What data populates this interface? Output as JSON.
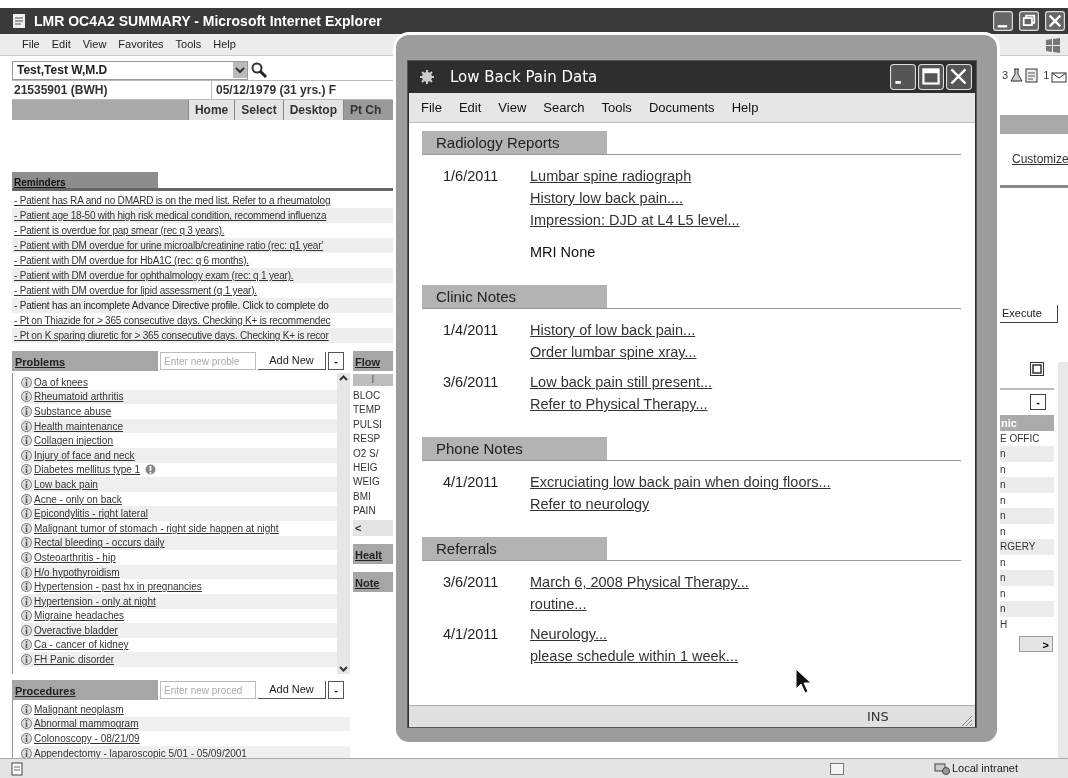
{
  "browser": {
    "title": "LMR OC4A2 SUMMARY - Microsoft Internet Explorer",
    "menu": [
      "File",
      "Edit",
      "View",
      "Favorites",
      "Tools",
      "Help"
    ]
  },
  "patient": {
    "name": "Test,Test W,M.D",
    "mrn": "21535901 (BWH)",
    "dob": "05/12/1979 (31 yrs.) F"
  },
  "nav_tabs": [
    {
      "label": "Home",
      "selected": false
    },
    {
      "label": "Select",
      "selected": false
    },
    {
      "label": "Desktop",
      "selected": false
    },
    {
      "label": "Pt Ch",
      "selected": true
    }
  ],
  "reminders": {
    "title": "Reminders",
    "items": [
      {
        "text": "- Patient has RA and no DMARD is on the med list. Refer to a rheumatolog",
        "link": true
      },
      {
        "text": "- Patient age 18-50 with high risk medical condition, recommend influenza",
        "link": true
      },
      {
        "text": "- Patient is overdue for pap smear (rec q 3 years).",
        "link": true
      },
      {
        "text": "- Patient with DM overdue for urine microalb/creatinine ratio (rec: q1 year'",
        "link": true
      },
      {
        "text": "- Patient with DM overdue for HbA1C (rec: q 6 months).",
        "link": true
      },
      {
        "text": "- Patient with DM overdue for ophthalmology exam (rec: q 1 year).",
        "link": true
      },
      {
        "text": "- Patient with DM overdue for lipid assessment (q 1 year).",
        "link": true
      },
      {
        "text": "- Patient has an incomplete Advance Directive profile. Click to complete do",
        "link": false
      },
      {
        "text": "- Pt on Thiazide for > 365 consecutive days. Checking K+ is recommendec",
        "link": true
      },
      {
        "text": "- Pt on K sparing diuretic for > 365 consecutive days. Checking K+ is recor",
        "link": true
      }
    ]
  },
  "problems": {
    "title": "Problems",
    "placeholder": "Enter new proble",
    "button": "Add New",
    "collapse": "-",
    "items": [
      {
        "text": "Oa of knees",
        "alert": false
      },
      {
        "text": "Rheumatoid arthritis",
        "alert": false
      },
      {
        "text": "Substance abuse",
        "alert": false
      },
      {
        "text": "Health maintenance",
        "alert": false
      },
      {
        "text": "Collagen injection",
        "alert": false
      },
      {
        "text": "Injury of face and neck",
        "alert": false
      },
      {
        "text": "Diabetes mellitus type 1",
        "alert": true
      },
      {
        "text": "Low back pain",
        "alert": false
      },
      {
        "text": "Acne - only on back",
        "alert": false
      },
      {
        "text": "Epicondylitis - right lateral",
        "alert": false
      },
      {
        "text": "Malignant tumor of stomach - right side happen at night",
        "alert": false
      },
      {
        "text": "Rectal bleeding - occurs daily",
        "alert": false
      },
      {
        "text": "Osteoarthritis - hip",
        "alert": false
      },
      {
        "text": "H/o hypothyroidism",
        "alert": false
      },
      {
        "text": "Hypertension - past hx in pregnancies",
        "alert": false
      },
      {
        "text": "Hypertension - only at night",
        "alert": false
      },
      {
        "text": "Migraine headaches",
        "alert": false
      },
      {
        "text": "Overactive bladder",
        "alert": false
      },
      {
        "text": "Ca - cancer of kidney",
        "alert": false
      },
      {
        "text": "FH Panic disorder",
        "alert": false
      }
    ]
  },
  "procedures": {
    "title": "Procedures",
    "placeholder": "Enter new proced",
    "button": "Add New",
    "collapse": "-",
    "items": [
      "Malignant neoplasm",
      "Abnormal mammogram",
      "Colonoscopy - 08/21/09",
      "Appendectomy - laparoscopic 5/01 - 05/09/2001"
    ]
  },
  "flowsheet": {
    "title": "Flow",
    "header": "I",
    "rows": [
      "BLOC",
      "TEMP",
      "PULSI",
      "RESP",
      "O2 S/",
      "HEIG",
      "WEIG",
      "BMI",
      "PAIN"
    ],
    "scroll": "<",
    "sections": [
      "Healt",
      "Note"
    ]
  },
  "right_panel": {
    "toolbar": [
      "3",
      "1"
    ],
    "customize": "Customize",
    "execute": "Execute",
    "collapse": "-",
    "column_header": "nic",
    "rows": [
      "E OFFIC",
      "n",
      "n",
      "n",
      "n",
      "n",
      "n",
      "RGERY",
      "n",
      "n",
      "n",
      "n",
      "H"
    ],
    "scroll": ">"
  },
  "status_bar": {
    "zone": "Local intranet"
  },
  "dialog": {
    "title": "Low Back Pain Data",
    "menu": [
      "File",
      "Edit",
      "View",
      "Search",
      "Tools",
      "Documents",
      "Help"
    ],
    "sections": [
      {
        "title": "Radiology Reports",
        "entries": [
          {
            "date": "1/6/2011",
            "lines": [
              "Lumbar spine radiograph",
              "History low back pain....",
              "Impression: DJD at L4 L5 level..."
            ]
          }
        ],
        "note": "MRI None"
      },
      {
        "title": "Clinic Notes",
        "entries": [
          {
            "date": "1/4/2011",
            "lines": [
              "History of low back pain...",
              "Order lumbar spine xray..."
            ]
          },
          {
            "date": "3/6/2011",
            "lines": [
              "Low back pain still present...",
              "Refer to Physical Therapy..."
            ]
          }
        ]
      },
      {
        "title": "Phone Notes",
        "entries": [
          {
            "date": "4/1/2011",
            "lines": [
              "Excruciating low back pain when doing floors...",
              "Refer to neurology"
            ]
          }
        ]
      },
      {
        "title": "Referrals",
        "entries": [
          {
            "date": "3/6/2011",
            "lines": [
              "March 6, 2008 Physical Therapy...",
              "routine..."
            ]
          },
          {
            "date": "4/1/2011",
            "lines": [
              "Neurology...",
              "please schedule within 1 week..."
            ]
          }
        ]
      }
    ],
    "status": "INS"
  }
}
